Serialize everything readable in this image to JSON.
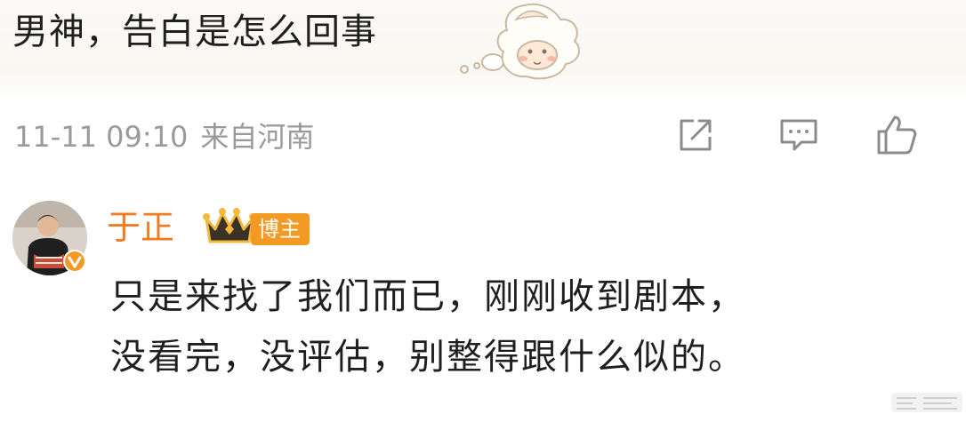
{
  "post": {
    "text": "男神，告白是怎么回事",
    "timestamp": "11-11 09:10",
    "location": "来自河南",
    "actions": [
      "share-icon",
      "comment-icon",
      "like-icon"
    ]
  },
  "reply": {
    "username": "于正",
    "badge": "博主",
    "lines": [
      "只是来找了我们而已，刚刚收到剧本，",
      "没看完，没评估，别整得跟什么似的。"
    ]
  },
  "colors": {
    "username": "#f07b22",
    "badge_bg": "#f39a25",
    "meta_text": "#9a9a9a",
    "body_text": "#1f1f1f"
  }
}
